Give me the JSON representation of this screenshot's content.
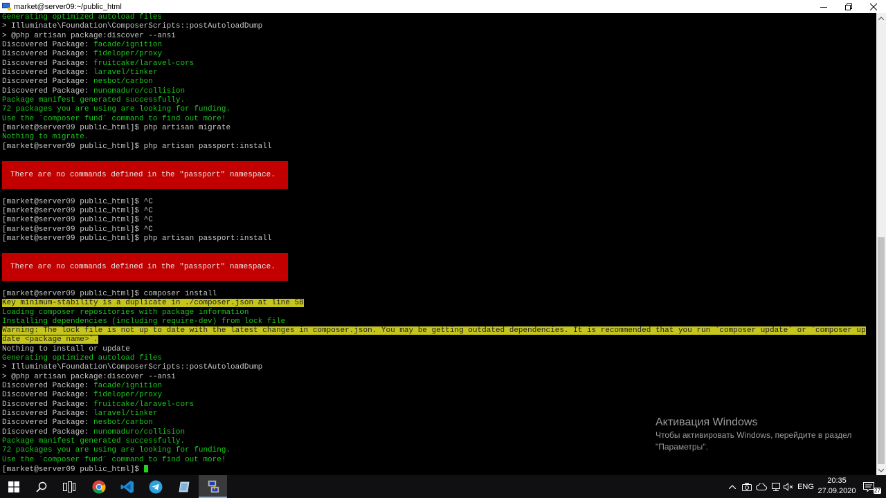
{
  "window": {
    "title": "market@server09:~/public_html"
  },
  "terminal": {
    "lines": [
      {
        "text": "Generating optimized autoload files",
        "color": "g"
      },
      {
        "text": "> Illuminate\\Foundation\\ComposerScripts::postAutoloadDump",
        "color": "w"
      },
      {
        "text": "> @php artisan package:discover --ansi",
        "color": "w"
      },
      {
        "prefix": "Discovered Package: ",
        "pkg": "facade/ignition"
      },
      {
        "prefix": "Discovered Package: ",
        "pkg": "fideloper/proxy"
      },
      {
        "prefix": "Discovered Package: ",
        "pkg": "fruitcake/laravel-cors"
      },
      {
        "prefix": "Discovered Package: ",
        "pkg": "laravel/tinker"
      },
      {
        "prefix": "Discovered Package: ",
        "pkg": "nesbot/carbon"
      },
      {
        "prefix": "Discovered Package: ",
        "pkg": "nunomaduro/collision"
      },
      {
        "text": "Package manifest generated successfully.",
        "color": "g"
      },
      {
        "text": "72 packages you are using are looking for funding.",
        "color": "g"
      },
      {
        "text": "Use the `composer fund` command to find out more!",
        "color": "g"
      },
      {
        "text": "[market@server09 public_html]$ php artisan migrate",
        "color": "w"
      },
      {
        "text": "Nothing to migrate.",
        "color": "g"
      },
      {
        "text": "[market@server09 public_html]$ php artisan passport:install",
        "color": "w"
      },
      {
        "text": "",
        "color": "w"
      },
      {
        "text": "",
        "color": "w"
      },
      {
        "text": "",
        "color": "w"
      },
      {
        "text": "",
        "color": "w"
      },
      {
        "text": "",
        "color": "w"
      },
      {
        "text": "[market@server09 public_html]$ ^C",
        "color": "w"
      },
      {
        "text": "[market@server09 public_html]$ ^C",
        "color": "w"
      },
      {
        "text": "[market@server09 public_html]$ ^C",
        "color": "w"
      },
      {
        "text": "[market@server09 public_html]$ ^C",
        "color": "w"
      },
      {
        "text": "[market@server09 public_html]$ php artisan passport:install",
        "color": "w"
      },
      {
        "text": "",
        "color": "w"
      },
      {
        "text": "",
        "color": "w"
      },
      {
        "text": "",
        "color": "w"
      },
      {
        "text": "",
        "color": "w"
      },
      {
        "text": "",
        "color": "w"
      },
      {
        "text": "[market@server09 public_html]$ composer install",
        "color": "w"
      },
      {
        "text": "Key minimum-stability is a duplicate in ./composer.json at line 58",
        "color": "hl"
      },
      {
        "text": "Loading composer repositories with package information",
        "color": "g"
      },
      {
        "text": "Installing dependencies (including require-dev) from lock file",
        "color": "g"
      },
      {
        "text": "Warning: The lock file is not up to date with the latest changes in composer.json. You may be getting outdated dependencies. It is recommended that you run `composer update` or `composer up",
        "color": "hl"
      },
      {
        "text": "date <package name>`.",
        "color": "hl"
      },
      {
        "text": "Nothing to install or update",
        "color": "w"
      },
      {
        "text": "Generating optimized autoload files",
        "color": "g"
      },
      {
        "text": "> Illuminate\\Foundation\\ComposerScripts::postAutoloadDump",
        "color": "w"
      },
      {
        "text": "> @php artisan package:discover --ansi",
        "color": "w"
      },
      {
        "prefix": "Discovered Package: ",
        "pkg": "facade/ignition"
      },
      {
        "prefix": "Discovered Package: ",
        "pkg": "fideloper/proxy"
      },
      {
        "prefix": "Discovered Package: ",
        "pkg": "fruitcake/laravel-cors"
      },
      {
        "prefix": "Discovered Package: ",
        "pkg": "laravel/tinker"
      },
      {
        "prefix": "Discovered Package: ",
        "pkg": "nesbot/carbon"
      },
      {
        "prefix": "Discovered Package: ",
        "pkg": "nunomaduro/collision"
      },
      {
        "text": "Package manifest generated successfully.",
        "color": "g"
      },
      {
        "text": "72 packages you are using are looking for funding.",
        "color": "g"
      },
      {
        "text": "Use the `composer fund` command to find out more!",
        "color": "g"
      },
      {
        "text": "[market@server09 public_html]$ ",
        "color": "w",
        "cursor": true
      }
    ],
    "error_box_1": "There are no commands defined in the \"passport\" namespace.",
    "error_box_2": "There are no commands defined in the \"passport\" namespace."
  },
  "activation": {
    "title": "Активация Windows",
    "line1": "Чтобы активировать Windows, перейдите в раздел",
    "line2": "\"Параметры\"."
  },
  "taskbar": {
    "language": "ENG",
    "time": "20:35",
    "date": "27.09.2020",
    "notifications": "27"
  },
  "colors": {
    "terminal_bg": "#000000",
    "text_white": "#c6c6c6",
    "text_green": "#1bc61b",
    "highlight_yellow": "#c5c51d",
    "error_red": "#c20000"
  }
}
